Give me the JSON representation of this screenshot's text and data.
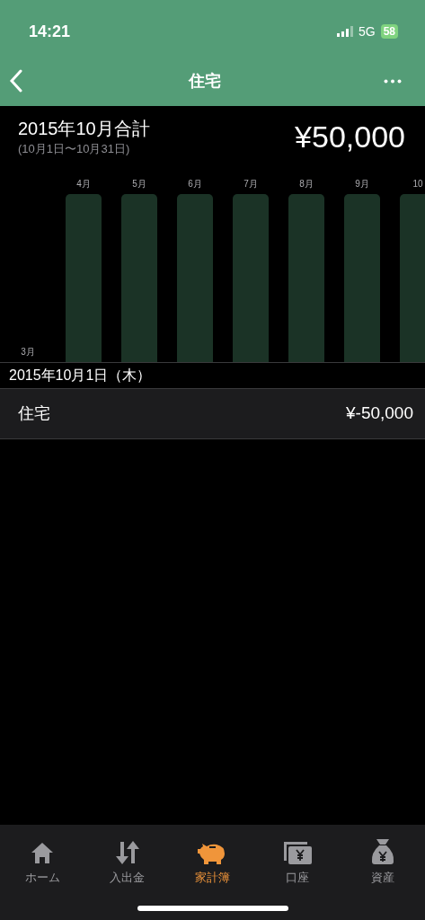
{
  "status_bar": {
    "time": "14:21",
    "network": "5G",
    "battery": "58"
  },
  "nav": {
    "title": "住宅"
  },
  "summary": {
    "title": "2015年10月合計",
    "period": "(10月1日〜10月31日)",
    "total": "¥50,000"
  },
  "months": [
    {
      "label": "3月",
      "kind": "empty"
    },
    {
      "label": "4月",
      "kind": "bar"
    },
    {
      "label": "5月",
      "kind": "bar"
    },
    {
      "label": "6月",
      "kind": "bar"
    },
    {
      "label": "7月",
      "kind": "bar"
    },
    {
      "label": "8月",
      "kind": "bar"
    },
    {
      "label": "9月",
      "kind": "bar"
    },
    {
      "label": "10",
      "kind": "bar"
    }
  ],
  "date_header": "2015年10月1日（木）",
  "entries": [
    {
      "name": "住宅",
      "amount": "¥-50,000"
    }
  ],
  "tabs": [
    {
      "label": "ホーム",
      "kind": "home",
      "selected": false
    },
    {
      "label": "入出金",
      "kind": "transfer",
      "selected": false
    },
    {
      "label": "家計簿",
      "kind": "piggy",
      "selected": true
    },
    {
      "label": "口座",
      "kind": "account",
      "selected": false
    },
    {
      "label": "資産",
      "kind": "asset",
      "selected": false
    }
  ]
}
